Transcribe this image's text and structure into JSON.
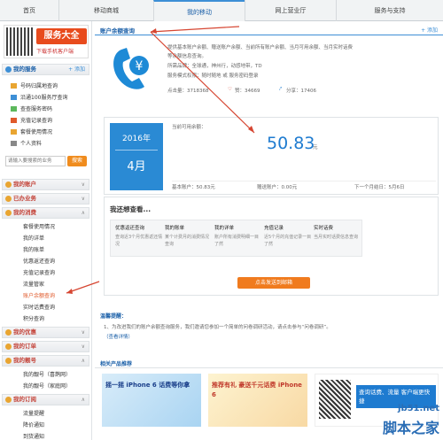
{
  "nav": {
    "tabs": [
      "首页",
      "移动商城",
      "我的移动",
      "网上营业厅",
      "服务与支持"
    ]
  },
  "sidebar": {
    "promo": {
      "title": "服务大全",
      "subtitle": "下载手机客户端"
    },
    "my_services": {
      "title": "我的服务",
      "add": "+ 添加",
      "items": [
        "号码归属地查询",
        "沿通100服务厅查询",
        "查查服务密码",
        "充值记录查询",
        "套餐使用情况",
        "个人资料"
      ]
    },
    "search": {
      "placeholder": "请输入要搜索的业务",
      "button": "搜索"
    },
    "sections": [
      {
        "title": "我的账户",
        "chev": "∨"
      },
      {
        "title": "已办业务",
        "chev": "∨"
      },
      {
        "title": "我的消费",
        "chev": "∧"
      }
    ],
    "consume_items": [
      "套餐使用情况",
      "我的详单",
      "我的账单",
      "优惠返还查询",
      "充值记录查询",
      "流量管家",
      "账户余额查询",
      "实时话费查询",
      "积分查询"
    ],
    "sections2": [
      {
        "title": "我的优惠",
        "chev": "∨"
      },
      {
        "title": "我的订单",
        "chev": "∨"
      },
      {
        "title": "我的靓号",
        "chev": "∧"
      }
    ],
    "number_items": [
      "我的靓号（喜鹊网）",
      "我的靓号（家庭网）"
    ],
    "sections3": [
      {
        "title": "我的订阅",
        "chev": "∧"
      }
    ],
    "sub_items": [
      "流量提醒",
      "降价通知",
      "到货通知"
    ]
  },
  "main": {
    "header": {
      "title": "账户余额查询",
      "add": "+ 添加"
    },
    "desc": [
      "提供基本账户余额、赠送账户余额、当前所有账户余额、当月可用余额、当月实时话费",
      "等余额信息查询。",
      "所需品牌：全球通，神州行，动感地带，TD",
      "服务模式权限：随时随地 或 服务密码登录"
    ],
    "stats": {
      "clicks": "点击量：3718368",
      "likes": "赞：34669",
      "share": "分享：17406"
    },
    "balance": {
      "year": "2016年",
      "month": "4月",
      "label": "当前可用余额：",
      "amount": "50.83",
      "unit": "元",
      "basic": "基本账户：50.83元",
      "gift": "赠送账户：0.00元",
      "cycle": "下一个月结日：5月6日"
    },
    "want": {
      "title": "我还想查看...",
      "items": [
        {
          "t": "优惠返还查询",
          "d": "查询近3个月优惠返还情况"
        },
        {
          "t": "我的账单",
          "d": "某个计费月的消费情况查询"
        },
        {
          "t": "我的详单",
          "d": "账户所有消费明细一目了然"
        },
        {
          "t": "充值记录",
          "d": "近5个月的充值记录一目了然"
        },
        {
          "t": "实时话费",
          "d": "当月实时话费信息查询"
        }
      ]
    },
    "email_button": "点击发送到邮箱",
    "tips": {
      "title": "温馨提醒：",
      "text": "1、为改进我们的账户余额查询服务，我们邀请您参加一个简单的问卷调研活动，请点击参与“问卷调研”。",
      "link": "（查看详情）"
    },
    "products": {
      "title": "相关产品推荐",
      "ad1": "摇一摇 iPhone 6 话费等你拿",
      "ad2": "推荐有礼 豪送千元话费 iPhone 6",
      "ad3": "查询话费、流量 客户端更快捷"
    },
    "watermark": {
      "site": "jb51.net",
      "name": "脚本之家"
    }
  },
  "colors": {
    "accent": "#3d8fd6",
    "amount": "#1e7bd0",
    "orange": "#f07b1e",
    "arrow": "#d64531"
  }
}
